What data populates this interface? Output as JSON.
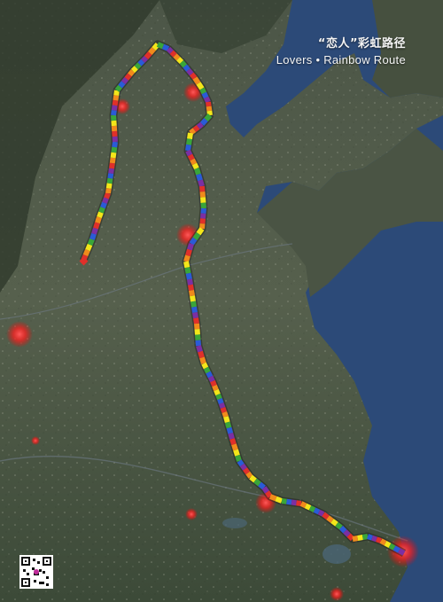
{
  "title": {
    "chinese": "“恋人”彩虹路径",
    "english": "Lovers • Rainbow Route"
  },
  "route_colors": [
    "#e0302a",
    "#f08a1c",
    "#f3e61a",
    "#3aa53a",
    "#2a5bd7",
    "#7b2fa3"
  ],
  "colors": {
    "sea": "#2c4a78",
    "land": "#3f4b3a",
    "city_glow": "#ff2b2b"
  }
}
